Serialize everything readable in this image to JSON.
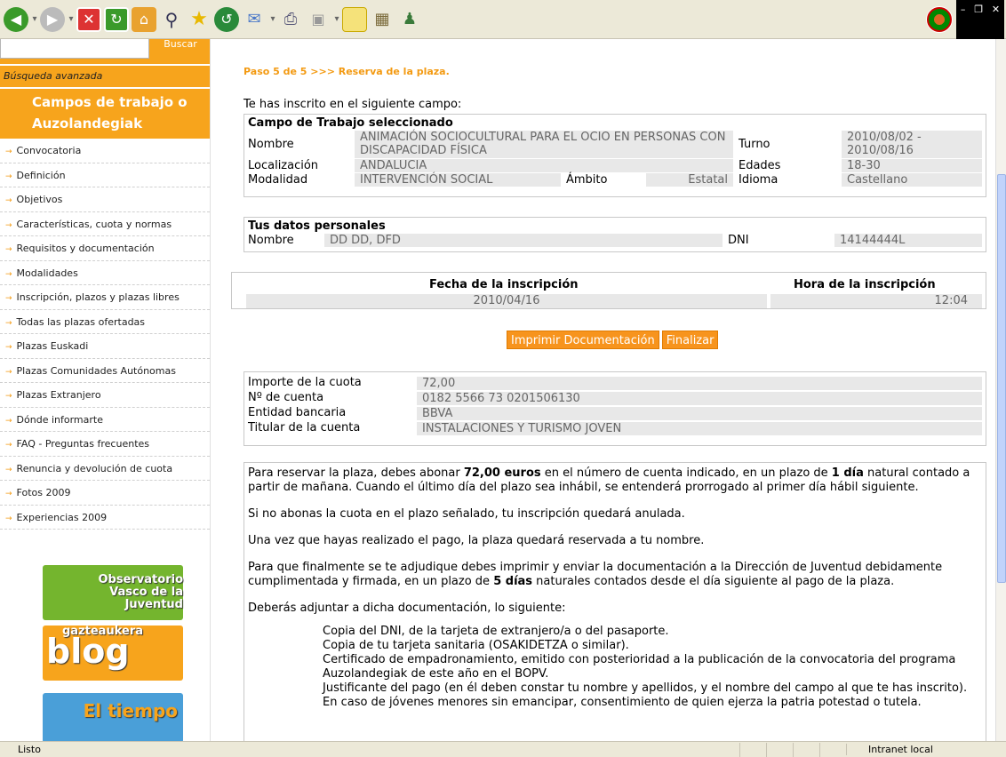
{
  "toolbar": {
    "icons": [
      "back-icon",
      "forward-icon",
      "stop-icon",
      "refresh-icon",
      "home-icon",
      "search-icon",
      "favorites-icon",
      "history-icon",
      "mail-icon",
      "print-icon",
      "edit-icon",
      "discuss-icon",
      "folder-icon",
      "messenger-icon"
    ]
  },
  "sidebar": {
    "search_button": "Buscar",
    "advanced_search": "Búsqueda avanzada",
    "section_title": "Campos de trabajo o Auzolandegiak",
    "items": [
      "Convocatoria",
      "Definición",
      "Objetivos",
      "Características, cuota y normas",
      "Requisitos y documentación",
      "Modalidades",
      "Inscripción, plazos y plazas libres",
      "Todas las plazas ofertadas",
      "Plazas Euskadi",
      "Plazas Comunidades Autónomas",
      "Plazas Extranjero",
      "Dónde informarte",
      "FAQ - Preguntas frecuentes",
      "Renuncia y devolución de cuota",
      "Fotos 2009",
      "Experiencias 2009"
    ],
    "banners": {
      "observatorio": "Observatorio Vasco de la Juventud",
      "blog_sub": "gazteaukera",
      "blog": "blog",
      "weather": "El tiempo"
    }
  },
  "main": {
    "step": "Paso 5 de 5 >>> Reserva de la plaza.",
    "intro": "Te has inscrito en el siguiente campo:",
    "campo": {
      "title": "Campo de Trabajo seleccionado",
      "nombre_label": "Nombre",
      "nombre_value": "ANIMACIÓN SOCIOCULTURAL PARA EL OCIO EN PERSONAS CON DISCAPACIDAD FÍSICA",
      "turno_label": "Turno",
      "turno_value": "2010/08/02 - 2010/08/16",
      "localizacion_label": "Localización",
      "localizacion_value": "ANDALUCIA",
      "edades_label": "Edades",
      "edades_value": "18-30",
      "modalidad_label": "Modalidad",
      "modalidad_value": "INTERVENCIÓN SOCIAL",
      "ambito_label": "Ámbito",
      "ambito_value": "Estatal",
      "idioma_label": "Idioma",
      "idioma_value": "Castellano"
    },
    "personal": {
      "title": "Tus datos personales",
      "nombre_label": "Nombre",
      "nombre_value": "DD DD, DFD",
      "dni_label": "DNI",
      "dni_value": "14144444L"
    },
    "inscripcion": {
      "fecha_label": "Fecha de la inscripción",
      "fecha_value": "2010/04/16",
      "hora_label": "Hora de la inscripción",
      "hora_value": "12:04"
    },
    "buttons": {
      "imprimir": "Imprimir Documentación",
      "finalizar": "Finalizar"
    },
    "pago": {
      "importe_label": "Importe de la cuota",
      "importe_value": "72,00",
      "cuenta_label": "Nº de cuenta",
      "cuenta_value": "0182 5566 73 0201506130",
      "entidad_label": "Entidad bancaria",
      "entidad_value": "BBVA",
      "titular_label": "Titular de la cuenta",
      "titular_value": "INSTALACIONES Y TURISMO JOVEN"
    },
    "text": {
      "p1_a": "Para reservar la plaza, debes abonar ",
      "p1_amount": "72,00 euros",
      "p1_b": " en el número de cuenta indicado, en un plazo de ",
      "p1_days": "1 día",
      "p1_c": " natural contado a partir de mañana. Cuando el último día del plazo sea inhábil, se entenderá prorrogado al primer día hábil siguiente.",
      "p2": "Si no abonas la cuota en el plazo señalado, tu inscripción quedará anulada.",
      "p3": "Una vez que hayas realizado el pago, la plaza quedará reservada a tu nombre.",
      "p4_a": "Para que finalmente se te adjudique debes imprimir y enviar la documentación a la Dirección de Juventud debidamente cumplimentada y firmada, en un plazo de ",
      "p4_days": "5 días",
      "p4_b": " naturales contados desde el día siguiente al pago de la plaza.",
      "p5": "Deberás adjuntar a dicha documentación, lo siguiente:",
      "list": [
        "Copia del DNI, de la tarjeta de extranjero/a o del pasaporte.",
        "Copia de tu tarjeta sanitaria (OSAKIDETZA o similar).",
        "Certificado de empadronamiento, emitido con posterioridad a la publicación de la convocatoria del programa Auzolandegiak de este año en el BOPV.",
        "Justificante del pago (en él deben constar tu nombre y apellidos, y el nombre del campo al que te has inscrito).",
        "En caso de jóvenes menores sin emancipar, consentimiento de quien ejerza la patria potestad o tutela."
      ]
    }
  },
  "status": {
    "left": "Listo",
    "zone": "Intranet local"
  }
}
